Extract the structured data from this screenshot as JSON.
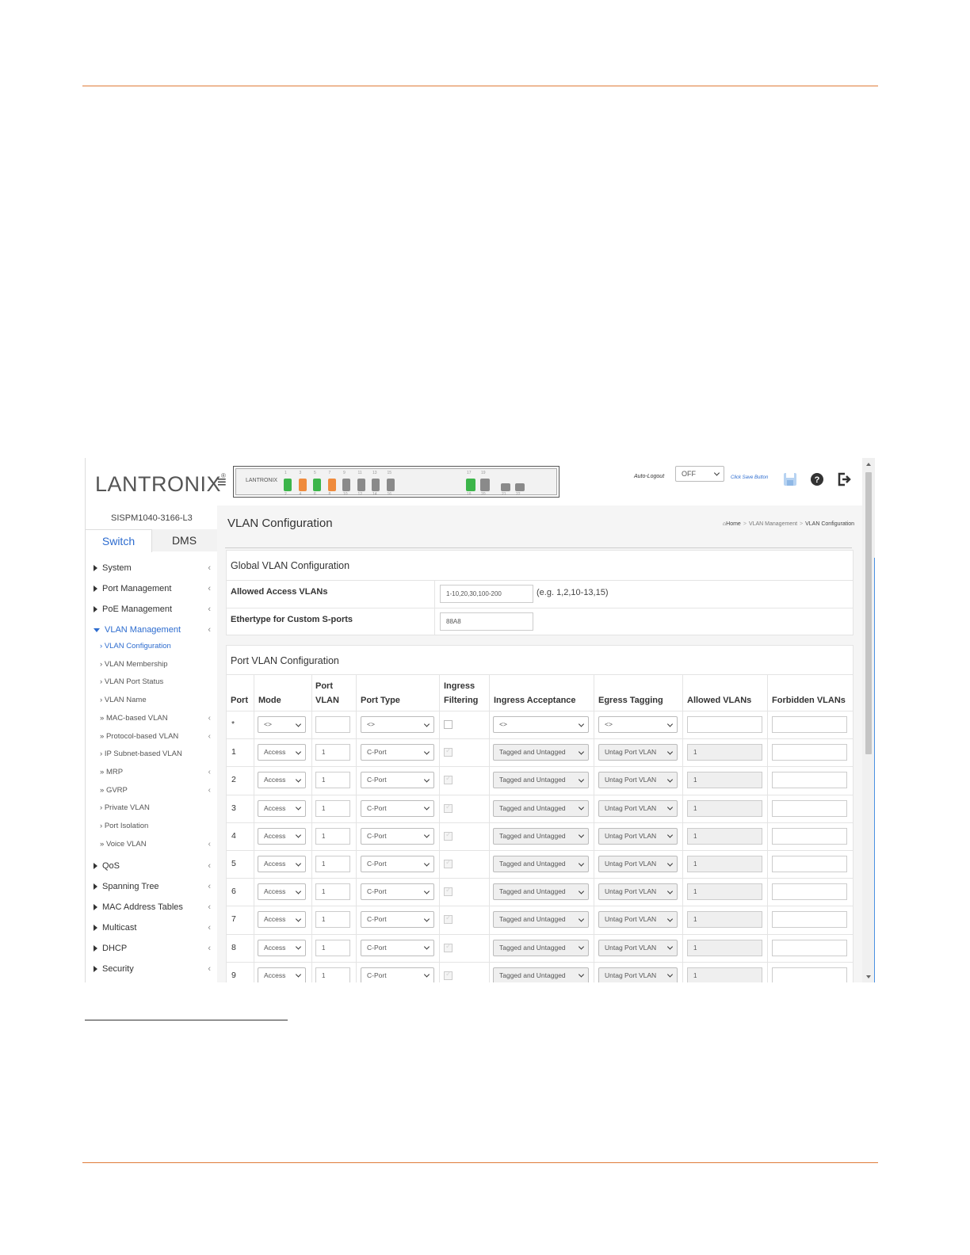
{
  "header": {
    "logo_text": "LANTRONIX",
    "logo_mark": "®",
    "auto_logout_label": "Auto-Logout",
    "auto_logout_value": "OFF",
    "save_hint": "Click Save Button",
    "front_panel_brand": "LANTRONIX",
    "ports_top": [
      "1",
      "3",
      "5",
      "7",
      "9",
      "11",
      "13",
      "15"
    ],
    "ports_bottom": [
      "2",
      "4",
      "6",
      "8",
      "10",
      "12",
      "14",
      "16"
    ],
    "sfp_top": [
      "17",
      "19"
    ],
    "sfp_bottom": [
      "18",
      "20",
      "21",
      "22"
    ],
    "icons": [
      "menu-icon",
      "save-icon",
      "help-icon",
      "logout-icon"
    ]
  },
  "sidebar": {
    "model": "SISPM1040-3166-L3",
    "tabs": [
      "Switch",
      "DMS"
    ],
    "menu": [
      {
        "label": "System"
      },
      {
        "label": "Port Management"
      },
      {
        "label": "PoE Management"
      },
      {
        "label": "VLAN Management",
        "active": true
      }
    ],
    "submenu": [
      {
        "label": "VLAN Configuration",
        "marker": "›",
        "active": true
      },
      {
        "label": "VLAN Membership",
        "marker": "›"
      },
      {
        "label": "VLAN Port Status",
        "marker": "›"
      },
      {
        "label": "VLAN Name",
        "marker": "›"
      },
      {
        "label": "MAC-based VLAN",
        "marker": "»",
        "has_children": true
      },
      {
        "label": "Protocol-based VLAN",
        "marker": "»",
        "has_children": true
      },
      {
        "label": "IP Subnet-based VLAN",
        "marker": "›"
      },
      {
        "label": "MRP",
        "marker": "»",
        "has_children": true
      },
      {
        "label": "GVRP",
        "marker": "»",
        "has_children": true
      },
      {
        "label": "Private VLAN",
        "marker": "›"
      },
      {
        "label": "Port Isolation",
        "marker": "›"
      },
      {
        "label": "Voice VLAN",
        "marker": "»",
        "has_children": true
      }
    ],
    "menu_after": [
      {
        "label": "QoS"
      },
      {
        "label": "Spanning Tree"
      },
      {
        "label": "MAC Address Tables"
      },
      {
        "label": "Multicast"
      },
      {
        "label": "DHCP"
      },
      {
        "label": "Security"
      }
    ]
  },
  "main": {
    "page_title": "VLAN Configuration",
    "breadcrumb": [
      "Home",
      "VLAN Management",
      "VLAN Configuration"
    ],
    "global": {
      "title": "Global VLAN Configuration",
      "allowed_access_label": "Allowed Access VLANs",
      "allowed_access_value": "1-10,20,30,100-200",
      "allowed_access_hint": "(e.g. 1,2,10-13,15)",
      "ethertype_label": "Ethertype for Custom S-ports",
      "ethertype_value": "88A8"
    },
    "port_vlan": {
      "title": "Port VLAN Configuration",
      "columns": {
        "port": "Port",
        "mode": "Mode",
        "port_vlan_1": "Port",
        "port_vlan_2": "VLAN",
        "port_type": "Port Type",
        "ingress_filtering_1": "Ingress",
        "ingress_filtering_2": "Filtering",
        "ingress_acceptance": "Ingress Acceptance",
        "egress_tagging": "Egress Tagging",
        "allowed_vlans": "Allowed VLANs",
        "forbidden_vlans": "Forbidden VLANs"
      },
      "wildcard_row": {
        "port": "*",
        "mode": "<>",
        "port_type": "<>",
        "ingress_acceptance": "<>",
        "egress_tagging": "<>"
      },
      "rows": [
        {
          "port": "1",
          "mode": "Access",
          "port_vlan": "1",
          "port_type": "C-Port",
          "ingress_acceptance": "Tagged and Untagged",
          "egress_tagging": "Untag Port VLAN",
          "allowed_vlans": "1"
        },
        {
          "port": "2",
          "mode": "Access",
          "port_vlan": "1",
          "port_type": "C-Port",
          "ingress_acceptance": "Tagged and Untagged",
          "egress_tagging": "Untag Port VLAN",
          "allowed_vlans": "1"
        },
        {
          "port": "3",
          "mode": "Access",
          "port_vlan": "1",
          "port_type": "C-Port",
          "ingress_acceptance": "Tagged and Untagged",
          "egress_tagging": "Untag Port VLAN",
          "allowed_vlans": "1"
        },
        {
          "port": "4",
          "mode": "Access",
          "port_vlan": "1",
          "port_type": "C-Port",
          "ingress_acceptance": "Tagged and Untagged",
          "egress_tagging": "Untag Port VLAN",
          "allowed_vlans": "1"
        },
        {
          "port": "5",
          "mode": "Access",
          "port_vlan": "1",
          "port_type": "C-Port",
          "ingress_acceptance": "Tagged and Untagged",
          "egress_tagging": "Untag Port VLAN",
          "allowed_vlans": "1"
        },
        {
          "port": "6",
          "mode": "Access",
          "port_vlan": "1",
          "port_type": "C-Port",
          "ingress_acceptance": "Tagged and Untagged",
          "egress_tagging": "Untag Port VLAN",
          "allowed_vlans": "1"
        },
        {
          "port": "7",
          "mode": "Access",
          "port_vlan": "1",
          "port_type": "C-Port",
          "ingress_acceptance": "Tagged and Untagged",
          "egress_tagging": "Untag Port VLAN",
          "allowed_vlans": "1"
        },
        {
          "port": "8",
          "mode": "Access",
          "port_vlan": "1",
          "port_type": "C-Port",
          "ingress_acceptance": "Tagged and Untagged",
          "egress_tagging": "Untag Port VLAN",
          "allowed_vlans": "1"
        },
        {
          "port": "9",
          "mode": "Access",
          "port_vlan": "1",
          "port_type": "C-Port",
          "ingress_acceptance": "Tagged and Untagged",
          "egress_tagging": "Untag Port VLAN",
          "allowed_vlans": "1"
        }
      ]
    }
  },
  "colors": {
    "accent": "#2d6ccf",
    "brand_orange": "#e07b39",
    "port_green": "#3cb54a",
    "port_orange": "#ef8b3d"
  }
}
